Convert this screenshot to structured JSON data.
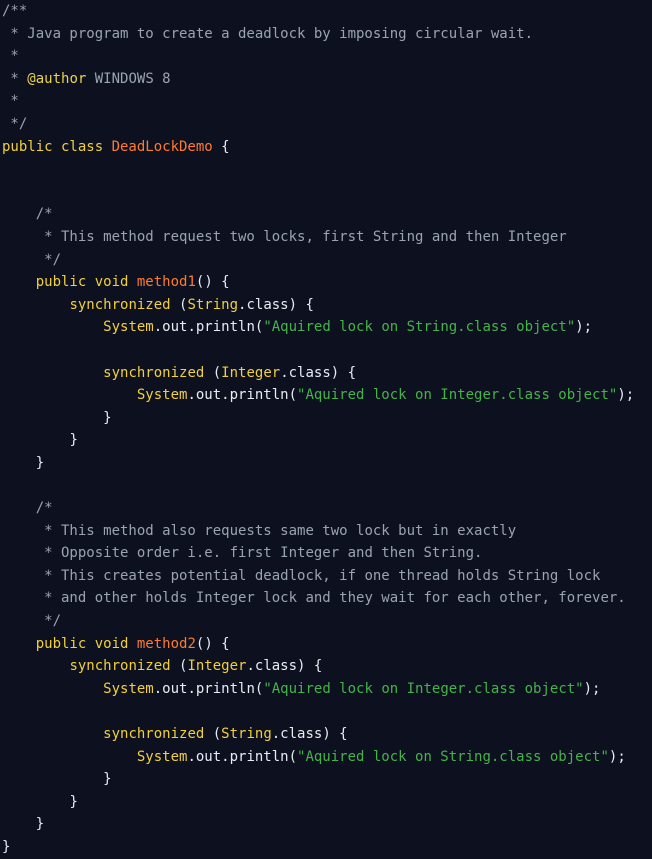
{
  "editor": {
    "name": "code-viewer",
    "language": "Java",
    "background_color": "#0d111f",
    "colors": {
      "comment": "#9aa3b2",
      "doc_tag": "#e8d44d",
      "keyword": "#f2d03b",
      "type_name": "#ff7a2f",
      "class_ref": "#f2d03b",
      "plain": "#e6edf3",
      "string": "#44b34a"
    }
  },
  "code": {
    "lines": [
      {
        "indent": 0,
        "tokens": [
          {
            "t": "/**",
            "c": "comment"
          }
        ]
      },
      {
        "indent": 0,
        "tokens": [
          {
            "t": " * Java program to create a deadlock by imposing circular wait.",
            "c": "comment"
          }
        ]
      },
      {
        "indent": 0,
        "tokens": [
          {
            "t": " *",
            "c": "comment"
          }
        ]
      },
      {
        "indent": 0,
        "tokens": [
          {
            "t": " * ",
            "c": "comment"
          },
          {
            "t": "@author",
            "c": "doctag"
          },
          {
            "t": " WINDOWS 8",
            "c": "comment"
          }
        ]
      },
      {
        "indent": 0,
        "tokens": [
          {
            "t": " *",
            "c": "comment"
          }
        ]
      },
      {
        "indent": 0,
        "tokens": [
          {
            "t": " */",
            "c": "comment"
          }
        ]
      },
      {
        "indent": 0,
        "tokens": [
          {
            "t": "public class ",
            "c": "keyword"
          },
          {
            "t": "DeadLockDemo",
            "c": "type"
          },
          {
            "t": " {",
            "c": "plain"
          }
        ]
      },
      {
        "indent": 0,
        "tokens": []
      },
      {
        "indent": 0,
        "tokens": []
      },
      {
        "indent": 4,
        "tokens": [
          {
            "t": "/*",
            "c": "comment"
          }
        ]
      },
      {
        "indent": 4,
        "tokens": [
          {
            "t": " * This method request two locks, first String and then Integer",
            "c": "comment"
          }
        ]
      },
      {
        "indent": 4,
        "tokens": [
          {
            "t": " */",
            "c": "comment"
          }
        ]
      },
      {
        "indent": 4,
        "tokens": [
          {
            "t": "public void ",
            "c": "keyword"
          },
          {
            "t": "method1",
            "c": "type"
          },
          {
            "t": "() {",
            "c": "plain"
          }
        ]
      },
      {
        "indent": 8,
        "tokens": [
          {
            "t": "synchronized ",
            "c": "keyword"
          },
          {
            "t": "(",
            "c": "plain"
          },
          {
            "t": "String",
            "c": "class"
          },
          {
            "t": ".class) {",
            "c": "plain"
          }
        ]
      },
      {
        "indent": 12,
        "tokens": [
          {
            "t": "System",
            "c": "ident"
          },
          {
            "t": ".out.println(",
            "c": "plain"
          },
          {
            "t": "\"Aquired lock on String.class object\"",
            "c": "string"
          },
          {
            "t": ");",
            "c": "plain"
          }
        ]
      },
      {
        "indent": 0,
        "tokens": []
      },
      {
        "indent": 12,
        "tokens": [
          {
            "t": "synchronized ",
            "c": "keyword"
          },
          {
            "t": "(",
            "c": "plain"
          },
          {
            "t": "Integer",
            "c": "class"
          },
          {
            "t": ".class) {",
            "c": "plain"
          }
        ]
      },
      {
        "indent": 16,
        "tokens": [
          {
            "t": "System",
            "c": "ident"
          },
          {
            "t": ".out.println(",
            "c": "plain"
          },
          {
            "t": "\"Aquired lock on Integer.class object\"",
            "c": "string"
          },
          {
            "t": ");",
            "c": "plain"
          }
        ]
      },
      {
        "indent": 12,
        "tokens": [
          {
            "t": "}",
            "c": "plain"
          }
        ]
      },
      {
        "indent": 8,
        "tokens": [
          {
            "t": "}",
            "c": "plain"
          }
        ]
      },
      {
        "indent": 4,
        "tokens": [
          {
            "t": "}",
            "c": "plain"
          }
        ]
      },
      {
        "indent": 0,
        "tokens": []
      },
      {
        "indent": 4,
        "tokens": [
          {
            "t": "/*",
            "c": "comment"
          }
        ]
      },
      {
        "indent": 4,
        "tokens": [
          {
            "t": " * This method also requests same two lock but in exactly",
            "c": "comment"
          }
        ]
      },
      {
        "indent": 4,
        "tokens": [
          {
            "t": " * Opposite order i.e. first Integer and then String.",
            "c": "comment"
          }
        ]
      },
      {
        "indent": 4,
        "tokens": [
          {
            "t": " * This creates potential deadlock, if one thread holds String lock",
            "c": "comment"
          }
        ]
      },
      {
        "indent": 4,
        "tokens": [
          {
            "t": " * and other holds Integer lock and they wait for each other, forever.",
            "c": "comment"
          }
        ]
      },
      {
        "indent": 4,
        "tokens": [
          {
            "t": " */",
            "c": "comment"
          }
        ]
      },
      {
        "indent": 4,
        "tokens": [
          {
            "t": "public void ",
            "c": "keyword"
          },
          {
            "t": "method2",
            "c": "type"
          },
          {
            "t": "() {",
            "c": "plain"
          }
        ]
      },
      {
        "indent": 8,
        "tokens": [
          {
            "t": "synchronized ",
            "c": "keyword"
          },
          {
            "t": "(",
            "c": "plain"
          },
          {
            "t": "Integer",
            "c": "class"
          },
          {
            "t": ".class) {",
            "c": "plain"
          }
        ]
      },
      {
        "indent": 12,
        "tokens": [
          {
            "t": "System",
            "c": "ident"
          },
          {
            "t": ".out.println(",
            "c": "plain"
          },
          {
            "t": "\"Aquired lock on Integer.class object\"",
            "c": "string"
          },
          {
            "t": ");",
            "c": "plain"
          }
        ]
      },
      {
        "indent": 0,
        "tokens": []
      },
      {
        "indent": 12,
        "tokens": [
          {
            "t": "synchronized ",
            "c": "keyword"
          },
          {
            "t": "(",
            "c": "plain"
          },
          {
            "t": "String",
            "c": "class"
          },
          {
            "t": ".class) {",
            "c": "plain"
          }
        ]
      },
      {
        "indent": 16,
        "tokens": [
          {
            "t": "System",
            "c": "ident"
          },
          {
            "t": ".out.println(",
            "c": "plain"
          },
          {
            "t": "\"Aquired lock on String.class object\"",
            "c": "string"
          },
          {
            "t": ");",
            "c": "plain"
          }
        ]
      },
      {
        "indent": 12,
        "tokens": [
          {
            "t": "}",
            "c": "plain"
          }
        ]
      },
      {
        "indent": 8,
        "tokens": [
          {
            "t": "}",
            "c": "plain"
          }
        ]
      },
      {
        "indent": 4,
        "tokens": [
          {
            "t": "}",
            "c": "plain"
          }
        ]
      },
      {
        "indent": 0,
        "tokens": [
          {
            "t": "}",
            "c": "plain"
          }
        ]
      }
    ]
  }
}
